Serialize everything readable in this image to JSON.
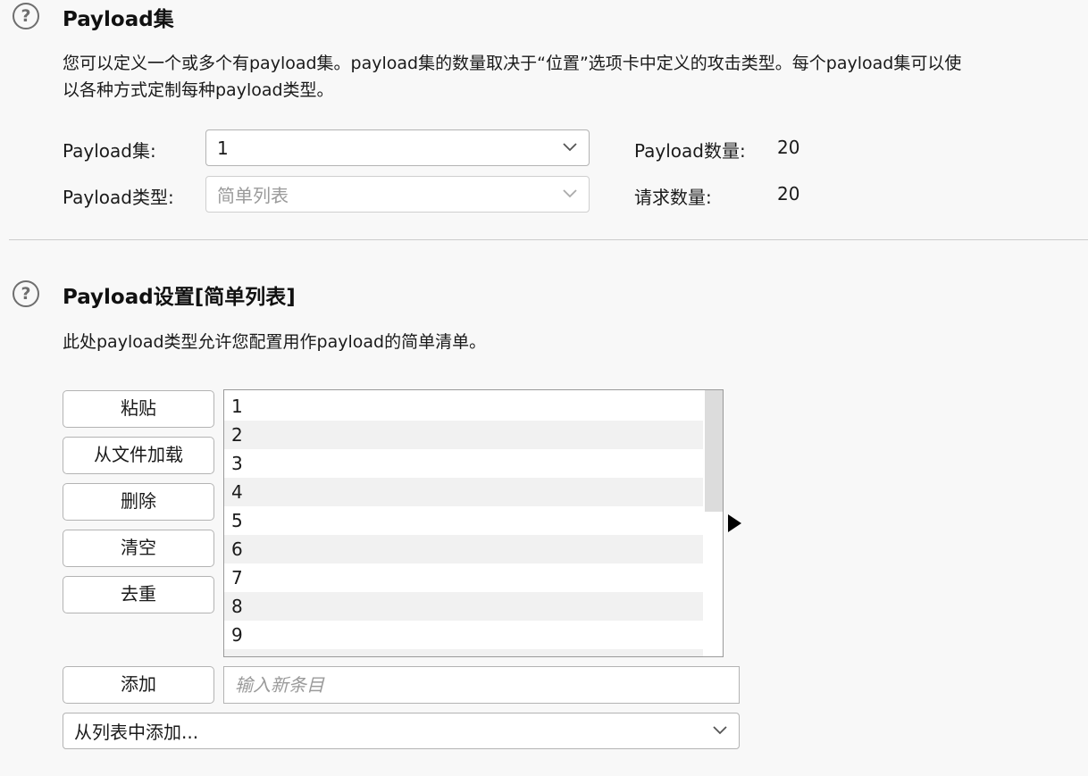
{
  "payload_sets": {
    "title": "Payload集",
    "description_line1": "您可以定义一个或多个有payload集。payload集的数量取决于“位置”选项卡中定义的攻击类型。每个payload集可以使",
    "description_line2": "以各种方式定制每种payload类型。",
    "set_label": "Payload集:",
    "set_value": "1",
    "type_label": "Payload类型:",
    "type_value": "简单列表",
    "count_label": "Payload数量:",
    "count_value": "20",
    "request_label": "请求数量:",
    "request_value": "20"
  },
  "payload_settings": {
    "title": "Payload设置[简单列表]",
    "description": "此处payload类型允许您配置用作payload的简单清单。",
    "buttons": {
      "paste": "粘贴",
      "load": "从文件加载",
      "remove": "删除",
      "clear": "清空",
      "dedupe": "去重",
      "add": "添加"
    },
    "list_items": [
      "1",
      "2",
      "3",
      "4",
      "5",
      "6",
      "7",
      "8",
      "9"
    ],
    "add_input_placeholder": "输入新条目",
    "add_from_list_label": "从列表中添加..."
  },
  "icons": {
    "help": "question-circle-icon",
    "dropdown": "chevron-down-icon",
    "expand": "triangle-right-icon"
  },
  "colors": {
    "background": "#f8f8f8",
    "border": "#b3b3b3",
    "list_alt_row": "#f1f1f1"
  }
}
